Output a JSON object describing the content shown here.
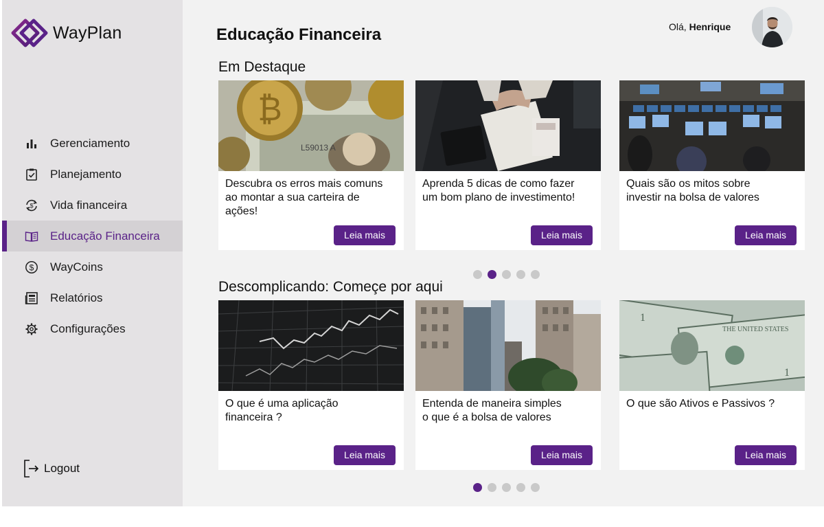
{
  "app": {
    "name": "WayPlan"
  },
  "colors": {
    "accent": "#5a2288",
    "sidebar_bg": "#e4e2e4",
    "main_bg": "#f2f2f2"
  },
  "sidebar": {
    "items": [
      {
        "label": "Gerenciamento",
        "icon": "bar-chart-icon",
        "active": false
      },
      {
        "label": "Planejamento",
        "icon": "clipboard-check-icon",
        "active": false
      },
      {
        "label": "Vida financeira",
        "icon": "money-cycle-icon",
        "active": false
      },
      {
        "label": "Educação Financeira",
        "icon": "open-book-icon",
        "active": true
      },
      {
        "label": "WayCoins",
        "icon": "dollar-coin-icon",
        "active": false
      },
      {
        "label": "Relatórios",
        "icon": "newspaper-icon",
        "active": false
      },
      {
        "label": "Configurações",
        "icon": "gear-icon",
        "active": false
      }
    ],
    "logout_label": "Logout"
  },
  "header": {
    "title": "Educação Financeira",
    "greeting": "Olá,",
    "user_name": "Henrique"
  },
  "sections": [
    {
      "title": "Em Destaque",
      "cards": [
        {
          "text": "Descubra os erros mais comuns\nao montar a sua carteira de\nações!",
          "button": "Leia mais",
          "image": "bitcoin-coins-on-dollar-bills"
        },
        {
          "text": "Aprenda 5 dicas de como fazer\num bom plano de investimento!",
          "button": "Leia mais",
          "image": "hands-counting-money-with-calculator"
        },
        {
          "text": "Quais são os mitos sobre\ninvestir na bolsa de valores",
          "button": "Leia mais",
          "image": "trading-room-monitors"
        }
      ],
      "pagination": {
        "pages": 5,
        "current": 2
      }
    },
    {
      "title": "Descomplicando: Começe por aqui",
      "cards": [
        {
          "text": "O que é uma aplicação\nfinanceira ?",
          "button": "Leia mais",
          "image": "stock-chart-screen"
        },
        {
          "text": "Entenda de maneira simples\no que é a bolsa de valores",
          "button": "Leia mais",
          "image": "city-skyscrapers"
        },
        {
          "text": "O que são Ativos e Passivos ?",
          "button": "Leia mais",
          "image": "dollar-bills"
        }
      ],
      "pagination": {
        "pages": 5,
        "current": 1
      }
    }
  ]
}
